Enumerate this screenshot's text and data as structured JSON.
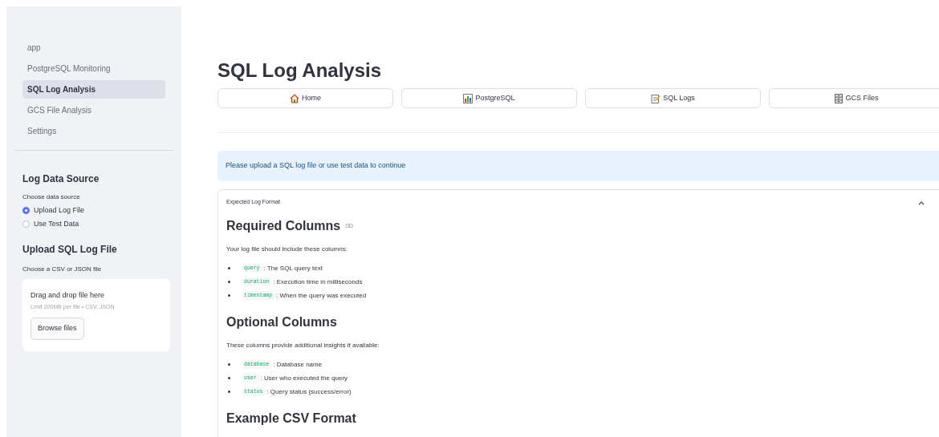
{
  "sidebar": {
    "nav": [
      {
        "label": "app",
        "selected": false
      },
      {
        "label": "PostgreSQL Monitoring",
        "selected": false
      },
      {
        "label": "SQL Log Analysis",
        "selected": true
      },
      {
        "label": "GCS File Analysis",
        "selected": false
      },
      {
        "label": "Settings",
        "selected": false
      }
    ],
    "source_heading": "Log Data Source",
    "source_label": "Choose data source",
    "sources": [
      {
        "label": "Upload Log File",
        "selected": true
      },
      {
        "label": "Use Test Data",
        "selected": false
      }
    ],
    "upload_heading": "Upload SQL Log File",
    "upload_label": "Choose a CSV or JSON file",
    "dropzone": {
      "title": "Drag and drop file here",
      "hint": "Limit 200MB per file • CSV, JSON",
      "button": "Browse files"
    }
  },
  "main": {
    "title": "SQL Log Analysis",
    "nav_buttons": [
      {
        "label": "Home"
      },
      {
        "label": "PostgreSQL"
      },
      {
        "label": "SQL Logs"
      },
      {
        "label": "GCS Files"
      }
    ],
    "info": "Please upload a SQL log file or use test data to continue",
    "expander": {
      "label": "Expected Log Format",
      "expanded": true,
      "sections": [
        {
          "heading": "Required Columns",
          "intro": "Your log file should include these columns:",
          "items": [
            {
              "code": "query",
              "text": ": The SQL query text"
            },
            {
              "code": "duration",
              "text": ": Execution time in milliseconds"
            },
            {
              "code": "timestamp",
              "text": ": When the query was executed"
            }
          ]
        },
        {
          "heading": "Optional Columns",
          "intro": "These columns provide additional insights if available:",
          "items": [
            {
              "code": "database",
              "text": ": Database name"
            },
            {
              "code": "user",
              "text": ": User who executed the query"
            },
            {
              "code": "status",
              "text": ": Query status (success/error)"
            }
          ]
        },
        {
          "heading": "Example CSV Format"
        }
      ]
    }
  }
}
